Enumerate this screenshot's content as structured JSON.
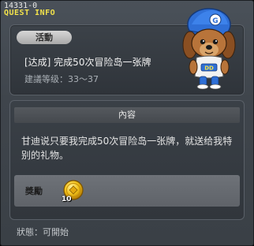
{
  "window": {
    "quest_id": "14331-0",
    "title": "QUEST INFO",
    "close_label": "×"
  },
  "quest": {
    "category": "活動",
    "name": "[达成] 完成50次冒险岛一张牌",
    "level": "建議等级：33～37"
  },
  "content": {
    "header": "內容",
    "description": "甘迪说只要我完成50次冒险岛一张牌，就送给我特别的礼物。"
  },
  "reward": {
    "label": "獎勵",
    "item_icon": "gold-coin-icon",
    "quantity": "10"
  },
  "status": {
    "text": "狀態：可開始"
  },
  "colors": {
    "title_accent": "#f2e24b",
    "npc_cap": "#2f6fd6",
    "npc_fur": "#b8743a"
  }
}
